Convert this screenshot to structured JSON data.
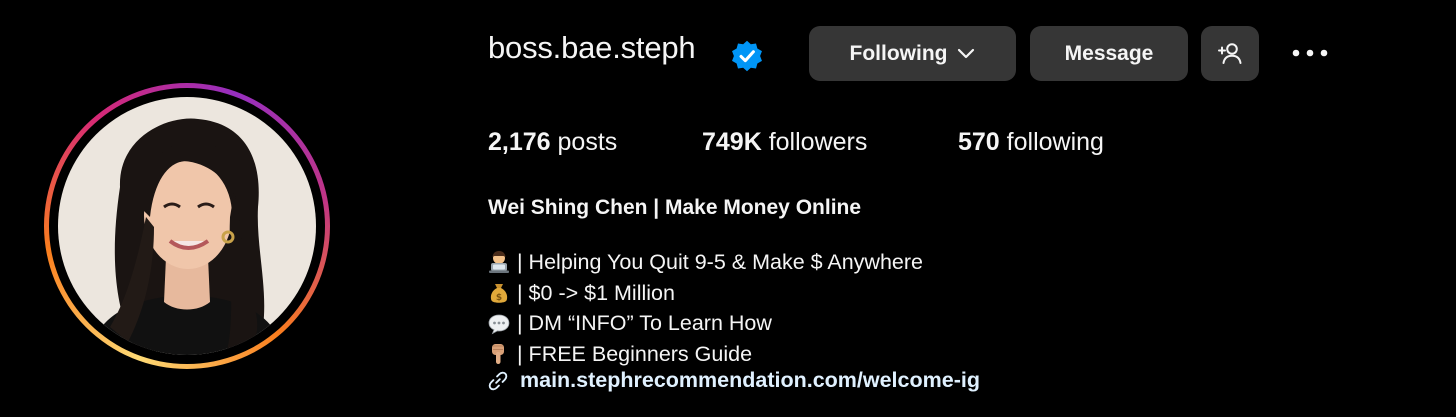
{
  "profile": {
    "username": "boss.bae.steph",
    "verified": true,
    "full_name": "Wei Shing Chen | Make Money Online"
  },
  "actions": {
    "following_label": "Following",
    "message_label": "Message"
  },
  "stats": {
    "posts_count": "2,176",
    "posts_label": " posts",
    "followers_count": "749K",
    "followers_label": " followers",
    "following_count": "570",
    "following_label": " following"
  },
  "bio": {
    "lines": [
      {
        "icon": "technologist-emoji-icon",
        "text": "| Helping You Quit 9-5 & Make $ Anywhere"
      },
      {
        "icon": "money-bag-emoji-icon",
        "text": "| $0 -> $1 Million"
      },
      {
        "icon": "speech-bubble-emoji-icon",
        "text": "| DM “INFO” To Learn How"
      },
      {
        "icon": "pointing-down-emoji-icon",
        "text": "| FREE Beginners Guide"
      }
    ],
    "link": "main.stephrecommendation.com/welcome-ig"
  },
  "colors": {
    "background": "#000000",
    "button_bg": "#363636",
    "verified_blue": "#0095f6",
    "link_text": "#e0f1ff"
  }
}
